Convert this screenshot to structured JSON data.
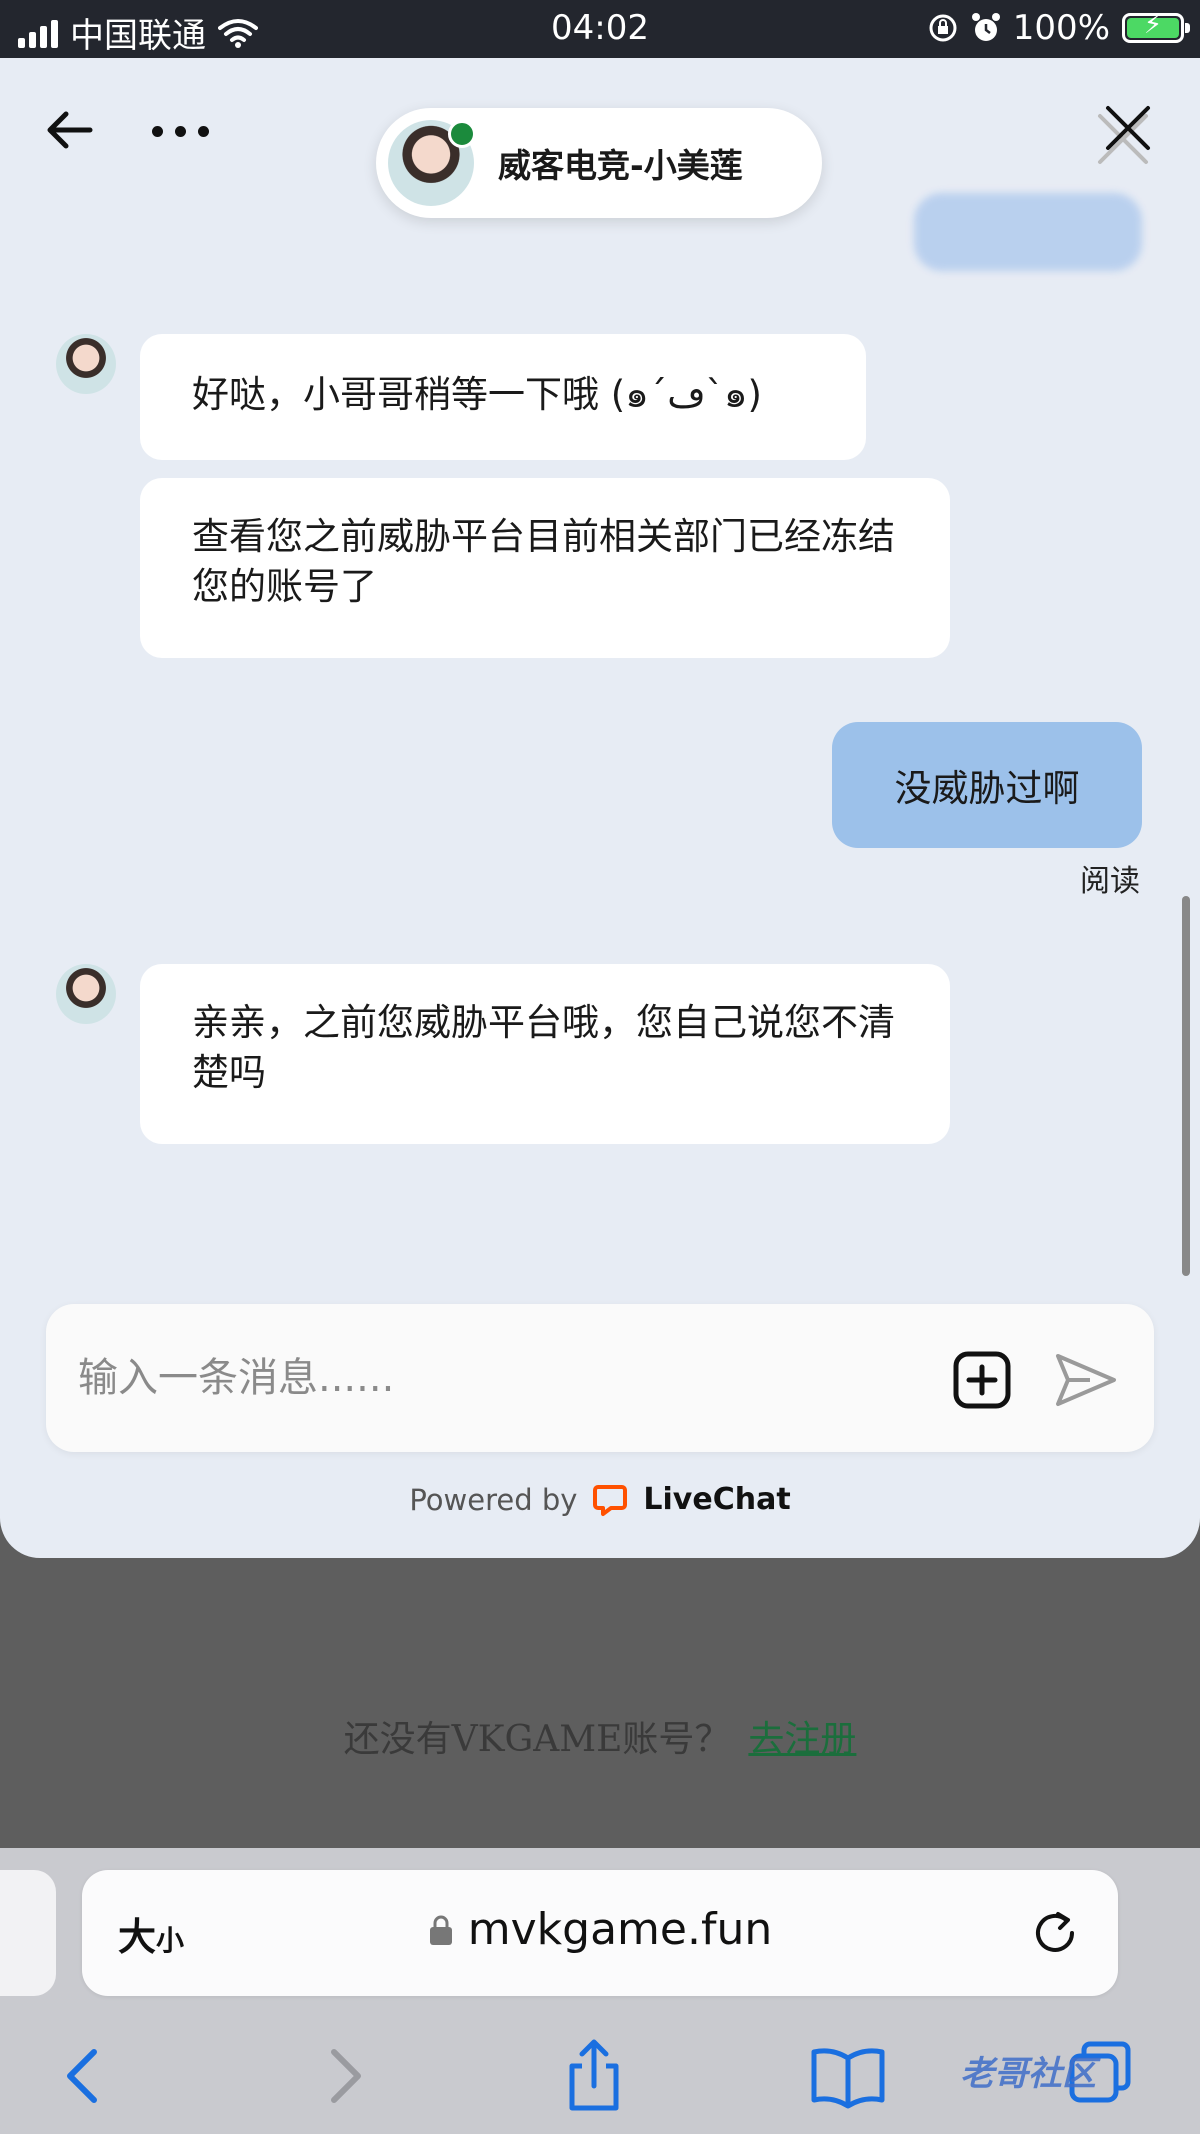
{
  "status_bar": {
    "carrier": "中国联通",
    "time": "04:02",
    "battery": "100%"
  },
  "chat": {
    "agent_name": "威客电竞-小美莲",
    "messages": [
      {
        "from": "agent",
        "text": "好哒，小哥哥稍等一下哦 (๑´ڡ`๑)"
      },
      {
        "from": "agent",
        "text": "查看您之前威胁平台目前相关部门已经冻结您的账号了"
      },
      {
        "from": "user",
        "text": "没威胁过啊",
        "status": "阅读"
      },
      {
        "from": "agent",
        "text": "亲亲，之前您威胁平台哦，您自己说您不清楚吗"
      }
    ],
    "composer_placeholder": "输入一条消息......",
    "powered_by": "Powered by",
    "brand": "LiveChat"
  },
  "page": {
    "signup_prompt": "还没有VKGAME账号？",
    "signup_link": "去注册"
  },
  "safari": {
    "text_size_label": "大",
    "text_size_small": "小",
    "url": "mvkgame.fun"
  },
  "watermark": "老哥社区",
  "colors": {
    "user_bubble": "#9cc1ea",
    "agent_bubble": "#ffffff",
    "chat_bg": "#e7ecf4",
    "online": "#1b8a3c",
    "link": "#1b6e3c",
    "livechat_orange": "#ff5100",
    "safari_blue": "#1a6fe0"
  }
}
